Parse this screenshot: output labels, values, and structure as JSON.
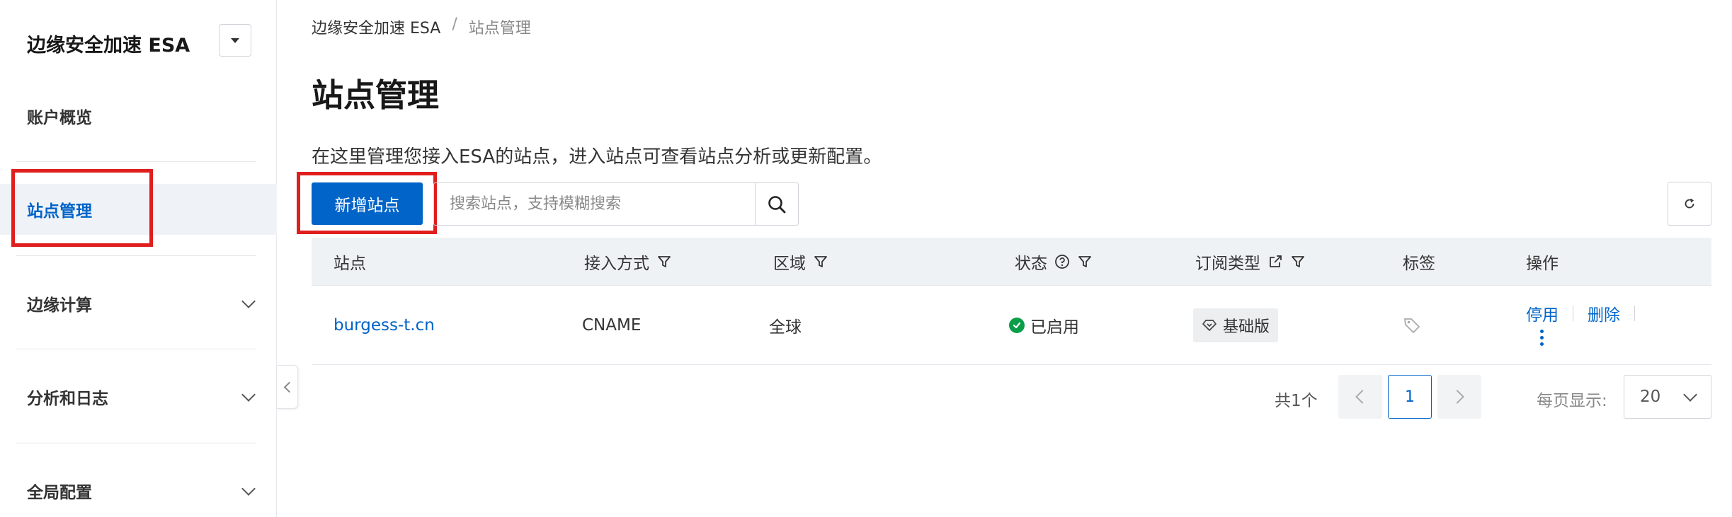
{
  "sidebar": {
    "title": "边缘安全加速 ESA",
    "items": [
      {
        "label": "账户概览"
      },
      {
        "label": "站点管理"
      },
      {
        "label": "边缘计算"
      },
      {
        "label": "分析和日志"
      },
      {
        "label": "全局配置"
      }
    ]
  },
  "breadcrumb": {
    "root": "边缘安全加速 ESA",
    "separator": "/",
    "current": "站点管理"
  },
  "page": {
    "title": "站点管理",
    "description": "在这里管理您接入ESA的站点，进入站点可查看站点分析或更新配置。"
  },
  "toolbar": {
    "add_label": "新增站点",
    "search_placeholder": "搜索站点，支持模糊搜索"
  },
  "table": {
    "columns": [
      "站点",
      "接入方式",
      "区域",
      "状态",
      "订阅类型",
      "标签",
      "操作"
    ],
    "rows": [
      {
        "site": "burgess-t.cn",
        "access": "CNAME",
        "region": "全球",
        "status": "已启用",
        "subscription": "基础版",
        "op_disable": "停用",
        "op_delete": "删除"
      }
    ]
  },
  "pagination": {
    "total": "共1个",
    "current_page": "1",
    "per_page_label": "每页显示:",
    "per_page_value": "20"
  },
  "colors": {
    "accent": "#0064c8",
    "success": "#0a9e48",
    "highlight": "#e01e1e"
  }
}
